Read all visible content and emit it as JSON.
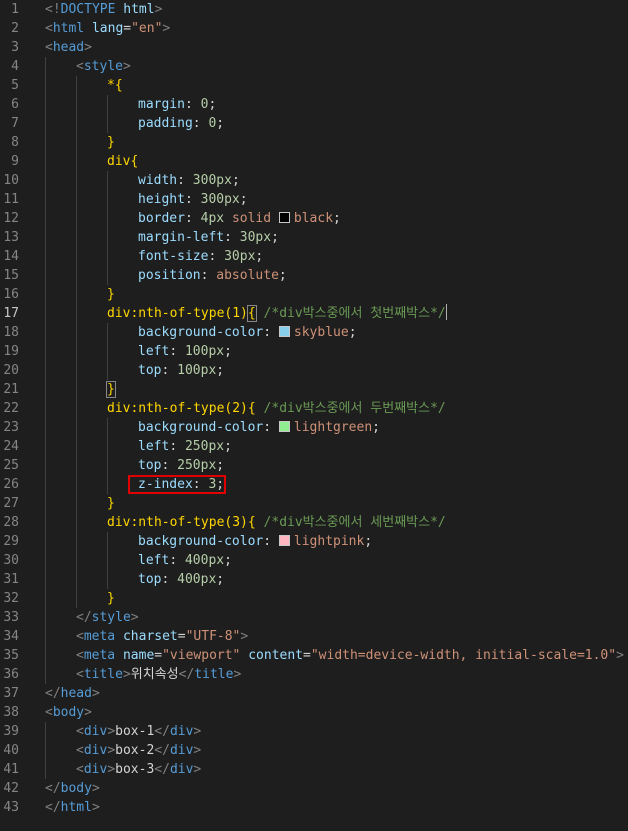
{
  "editor": {
    "current_line": 17,
    "highlight_line": 26,
    "colors": {
      "skyblue": "#87ceeb",
      "lightgreen": "#90ee90",
      "lightpink": "#ffb6c1",
      "black": "#000000",
      "annotation_box": "#e00000"
    },
    "lines": [
      {
        "n": "1",
        "indent": 0,
        "tokens": [
          {
            "c": "d",
            "t": "<!"
          },
          {
            "c": "k",
            "t": "DOCTYPE"
          },
          {
            "c": "p",
            "t": " "
          },
          {
            "c": "a",
            "t": "html"
          },
          {
            "c": "d",
            "t": ">"
          }
        ]
      },
      {
        "n": "2",
        "indent": 0,
        "tokens": [
          {
            "c": "d",
            "t": "<"
          },
          {
            "c": "k",
            "t": "html"
          },
          {
            "c": "p",
            "t": " "
          },
          {
            "c": "a",
            "t": "lang"
          },
          {
            "c": "p",
            "t": "="
          },
          {
            "c": "s",
            "t": "\"en\""
          },
          {
            "c": "d",
            "t": ">"
          }
        ]
      },
      {
        "n": "3",
        "indent": 0,
        "tokens": [
          {
            "c": "d",
            "t": "<"
          },
          {
            "c": "k",
            "t": "head"
          },
          {
            "c": "d",
            "t": ">"
          }
        ]
      },
      {
        "n": "4",
        "indent": 1,
        "tokens": [
          {
            "c": "d",
            "t": "<"
          },
          {
            "c": "k",
            "t": "style"
          },
          {
            "c": "d",
            "t": ">"
          }
        ]
      },
      {
        "n": "5",
        "indent": 2,
        "tokens": [
          {
            "c": "y",
            "t": "*"
          },
          {
            "c": "y",
            "t": "{"
          }
        ]
      },
      {
        "n": "6",
        "indent": 3,
        "tokens": [
          {
            "c": "a",
            "t": "margin"
          },
          {
            "c": "p",
            "t": ": "
          },
          {
            "c": "n",
            "t": "0"
          },
          {
            "c": "p",
            "t": ";"
          }
        ]
      },
      {
        "n": "7",
        "indent": 3,
        "tokens": [
          {
            "c": "a",
            "t": "padding"
          },
          {
            "c": "p",
            "t": ": "
          },
          {
            "c": "n",
            "t": "0"
          },
          {
            "c": "p",
            "t": ";"
          }
        ]
      },
      {
        "n": "8",
        "indent": 2,
        "tokens": [
          {
            "c": "y",
            "t": "}"
          }
        ]
      },
      {
        "n": "9",
        "indent": 2,
        "tokens": [
          {
            "c": "y",
            "t": "div"
          },
          {
            "c": "y",
            "t": "{"
          }
        ]
      },
      {
        "n": "10",
        "indent": 3,
        "tokens": [
          {
            "c": "a",
            "t": "width"
          },
          {
            "c": "p",
            "t": ": "
          },
          {
            "c": "n",
            "t": "300px"
          },
          {
            "c": "p",
            "t": ";"
          }
        ]
      },
      {
        "n": "11",
        "indent": 3,
        "tokens": [
          {
            "c": "a",
            "t": "height"
          },
          {
            "c": "p",
            "t": ": "
          },
          {
            "c": "n",
            "t": "300px"
          },
          {
            "c": "p",
            "t": ";"
          }
        ]
      },
      {
        "n": "12",
        "indent": 3,
        "tokens": [
          {
            "c": "a",
            "t": "border"
          },
          {
            "c": "p",
            "t": ": "
          },
          {
            "c": "n",
            "t": "4px"
          },
          {
            "c": "p",
            "t": " "
          },
          {
            "c": "s",
            "t": "solid"
          },
          {
            "c": "p",
            "t": " "
          },
          {
            "c": "sw",
            "t": "",
            "color": "#000000"
          },
          {
            "c": "s",
            "t": "black"
          },
          {
            "c": "p",
            "t": ";"
          }
        ]
      },
      {
        "n": "13",
        "indent": 3,
        "tokens": [
          {
            "c": "a",
            "t": "margin-left"
          },
          {
            "c": "p",
            "t": ": "
          },
          {
            "c": "n",
            "t": "30px"
          },
          {
            "c": "p",
            "t": ";"
          }
        ]
      },
      {
        "n": "14",
        "indent": 3,
        "tokens": [
          {
            "c": "a",
            "t": "font-size"
          },
          {
            "c": "p",
            "t": ": "
          },
          {
            "c": "n",
            "t": "30px"
          },
          {
            "c": "p",
            "t": ";"
          }
        ]
      },
      {
        "n": "15",
        "indent": 3,
        "tokens": [
          {
            "c": "a",
            "t": "position"
          },
          {
            "c": "p",
            "t": ": "
          },
          {
            "c": "s",
            "t": "absolute"
          },
          {
            "c": "p",
            "t": ";"
          }
        ]
      },
      {
        "n": "16",
        "indent": 2,
        "tokens": [
          {
            "c": "y",
            "t": "}"
          }
        ]
      },
      {
        "n": "17",
        "indent": 2,
        "tokens": [
          {
            "c": "y",
            "t": "div:nth-of-type(1)"
          },
          {
            "c": "ym",
            "t": "{"
          },
          {
            "c": "p",
            "t": " "
          },
          {
            "c": "c",
            "t": "/*div박스중에서 첫번째박스*/"
          },
          {
            "c": "cur",
            "t": ""
          }
        ]
      },
      {
        "n": "18",
        "indent": 3,
        "tokens": [
          {
            "c": "a",
            "t": "background-color"
          },
          {
            "c": "p",
            "t": ": "
          },
          {
            "c": "sw",
            "t": "",
            "color": "#87ceeb"
          },
          {
            "c": "s",
            "t": "skyblue"
          },
          {
            "c": "p",
            "t": ";"
          }
        ]
      },
      {
        "n": "19",
        "indent": 3,
        "tokens": [
          {
            "c": "a",
            "t": "left"
          },
          {
            "c": "p",
            "t": ": "
          },
          {
            "c": "n",
            "t": "100px"
          },
          {
            "c": "p",
            "t": ";"
          }
        ]
      },
      {
        "n": "20",
        "indent": 3,
        "tokens": [
          {
            "c": "a",
            "t": "top"
          },
          {
            "c": "p",
            "t": ": "
          },
          {
            "c": "n",
            "t": "100px"
          },
          {
            "c": "p",
            "t": ";"
          }
        ]
      },
      {
        "n": "21",
        "indent": 2,
        "tokens": [
          {
            "c": "ym",
            "t": "}"
          }
        ]
      },
      {
        "n": "22",
        "indent": 2,
        "tokens": [
          {
            "c": "y",
            "t": "div:nth-of-type(2)"
          },
          {
            "c": "y",
            "t": "{"
          },
          {
            "c": "p",
            "t": " "
          },
          {
            "c": "c",
            "t": "/*div박스중에서 두번째박스*/"
          }
        ]
      },
      {
        "n": "23",
        "indent": 3,
        "tokens": [
          {
            "c": "a",
            "t": "background-color"
          },
          {
            "c": "p",
            "t": ": "
          },
          {
            "c": "sw",
            "t": "",
            "color": "#90ee90"
          },
          {
            "c": "s",
            "t": "lightgreen"
          },
          {
            "c": "p",
            "t": ";"
          }
        ]
      },
      {
        "n": "24",
        "indent": 3,
        "tokens": [
          {
            "c": "a",
            "t": "left"
          },
          {
            "c": "p",
            "t": ": "
          },
          {
            "c": "n",
            "t": "250px"
          },
          {
            "c": "p",
            "t": ";"
          }
        ]
      },
      {
        "n": "25",
        "indent": 3,
        "tokens": [
          {
            "c": "a",
            "t": "top"
          },
          {
            "c": "p",
            "t": ": "
          },
          {
            "c": "n",
            "t": "250px"
          },
          {
            "c": "p",
            "t": ";"
          }
        ]
      },
      {
        "n": "26",
        "indent": 3,
        "tokens": [
          {
            "c": "a",
            "t": "z-index"
          },
          {
            "c": "p",
            "t": ": "
          },
          {
            "c": "n",
            "t": "3"
          },
          {
            "c": "p",
            "t": ";"
          }
        ]
      },
      {
        "n": "27",
        "indent": 2,
        "tokens": [
          {
            "c": "y",
            "t": "}"
          }
        ]
      },
      {
        "n": "28",
        "indent": 2,
        "tokens": [
          {
            "c": "y",
            "t": "div:nth-of-type(3)"
          },
          {
            "c": "y",
            "t": "{"
          },
          {
            "c": "p",
            "t": " "
          },
          {
            "c": "c",
            "t": "/*div박스중에서 세번째박스*/"
          }
        ]
      },
      {
        "n": "29",
        "indent": 3,
        "tokens": [
          {
            "c": "a",
            "t": "background-color"
          },
          {
            "c": "p",
            "t": ": "
          },
          {
            "c": "sw",
            "t": "",
            "color": "#ffb6c1"
          },
          {
            "c": "s",
            "t": "lightpink"
          },
          {
            "c": "p",
            "t": ";"
          }
        ]
      },
      {
        "n": "30",
        "indent": 3,
        "tokens": [
          {
            "c": "a",
            "t": "left"
          },
          {
            "c": "p",
            "t": ": "
          },
          {
            "c": "n",
            "t": "400px"
          },
          {
            "c": "p",
            "t": ";"
          }
        ]
      },
      {
        "n": "31",
        "indent": 3,
        "tokens": [
          {
            "c": "a",
            "t": "top"
          },
          {
            "c": "p",
            "t": ": "
          },
          {
            "c": "n",
            "t": "400px"
          },
          {
            "c": "p",
            "t": ";"
          }
        ]
      },
      {
        "n": "32",
        "indent": 2,
        "tokens": [
          {
            "c": "y",
            "t": "}"
          }
        ]
      },
      {
        "n": "33",
        "indent": 1,
        "tokens": [
          {
            "c": "d",
            "t": "</"
          },
          {
            "c": "k",
            "t": "style"
          },
          {
            "c": "d",
            "t": ">"
          }
        ]
      },
      {
        "n": "34",
        "indent": 1,
        "tokens": [
          {
            "c": "d",
            "t": "<"
          },
          {
            "c": "k",
            "t": "meta"
          },
          {
            "c": "p",
            "t": " "
          },
          {
            "c": "a",
            "t": "charset"
          },
          {
            "c": "p",
            "t": "="
          },
          {
            "c": "s",
            "t": "\"UTF-8\""
          },
          {
            "c": "d",
            "t": ">"
          }
        ]
      },
      {
        "n": "35",
        "indent": 1,
        "tokens": [
          {
            "c": "d",
            "t": "<"
          },
          {
            "c": "k",
            "t": "meta"
          },
          {
            "c": "p",
            "t": " "
          },
          {
            "c": "a",
            "t": "name"
          },
          {
            "c": "p",
            "t": "="
          },
          {
            "c": "s",
            "t": "\"viewport\""
          },
          {
            "c": "p",
            "t": " "
          },
          {
            "c": "a",
            "t": "content"
          },
          {
            "c": "p",
            "t": "="
          },
          {
            "c": "s",
            "t": "\"width=device-width, initial-scale=1.0\""
          },
          {
            "c": "d",
            "t": ">"
          }
        ]
      },
      {
        "n": "36",
        "indent": 1,
        "tokens": [
          {
            "c": "d",
            "t": "<"
          },
          {
            "c": "k",
            "t": "title"
          },
          {
            "c": "d",
            "t": ">"
          },
          {
            "c": "p",
            "t": "위치속성"
          },
          {
            "c": "d",
            "t": "</"
          },
          {
            "c": "k",
            "t": "title"
          },
          {
            "c": "d",
            "t": ">"
          }
        ]
      },
      {
        "n": "37",
        "indent": 0,
        "tokens": [
          {
            "c": "d",
            "t": "</"
          },
          {
            "c": "k",
            "t": "head"
          },
          {
            "c": "d",
            "t": ">"
          }
        ]
      },
      {
        "n": "38",
        "indent": 0,
        "tokens": [
          {
            "c": "d",
            "t": "<"
          },
          {
            "c": "k",
            "t": "body"
          },
          {
            "c": "d",
            "t": ">"
          }
        ]
      },
      {
        "n": "39",
        "indent": 1,
        "tokens": [
          {
            "c": "d",
            "t": "<"
          },
          {
            "c": "k",
            "t": "div"
          },
          {
            "c": "d",
            "t": ">"
          },
          {
            "c": "p",
            "t": "box-1"
          },
          {
            "c": "d",
            "t": "</"
          },
          {
            "c": "k",
            "t": "div"
          },
          {
            "c": "d",
            "t": ">"
          }
        ]
      },
      {
        "n": "40",
        "indent": 1,
        "tokens": [
          {
            "c": "d",
            "t": "<"
          },
          {
            "c": "k",
            "t": "div"
          },
          {
            "c": "d",
            "t": ">"
          },
          {
            "c": "p",
            "t": "box-2"
          },
          {
            "c": "d",
            "t": "</"
          },
          {
            "c": "k",
            "t": "div"
          },
          {
            "c": "d",
            "t": ">"
          }
        ]
      },
      {
        "n": "41",
        "indent": 1,
        "tokens": [
          {
            "c": "d",
            "t": "<"
          },
          {
            "c": "k",
            "t": "div"
          },
          {
            "c": "d",
            "t": ">"
          },
          {
            "c": "p",
            "t": "box-3"
          },
          {
            "c": "d",
            "t": "</"
          },
          {
            "c": "k",
            "t": "div"
          },
          {
            "c": "d",
            "t": ">"
          }
        ]
      },
      {
        "n": "42",
        "indent": 0,
        "tokens": [
          {
            "c": "d",
            "t": "</"
          },
          {
            "c": "k",
            "t": "body"
          },
          {
            "c": "d",
            "t": ">"
          }
        ]
      },
      {
        "n": "43",
        "indent": 0,
        "tokens": [
          {
            "c": "d",
            "t": "</"
          },
          {
            "c": "k",
            "t": "html"
          },
          {
            "c": "d",
            "t": ">"
          }
        ]
      }
    ]
  }
}
